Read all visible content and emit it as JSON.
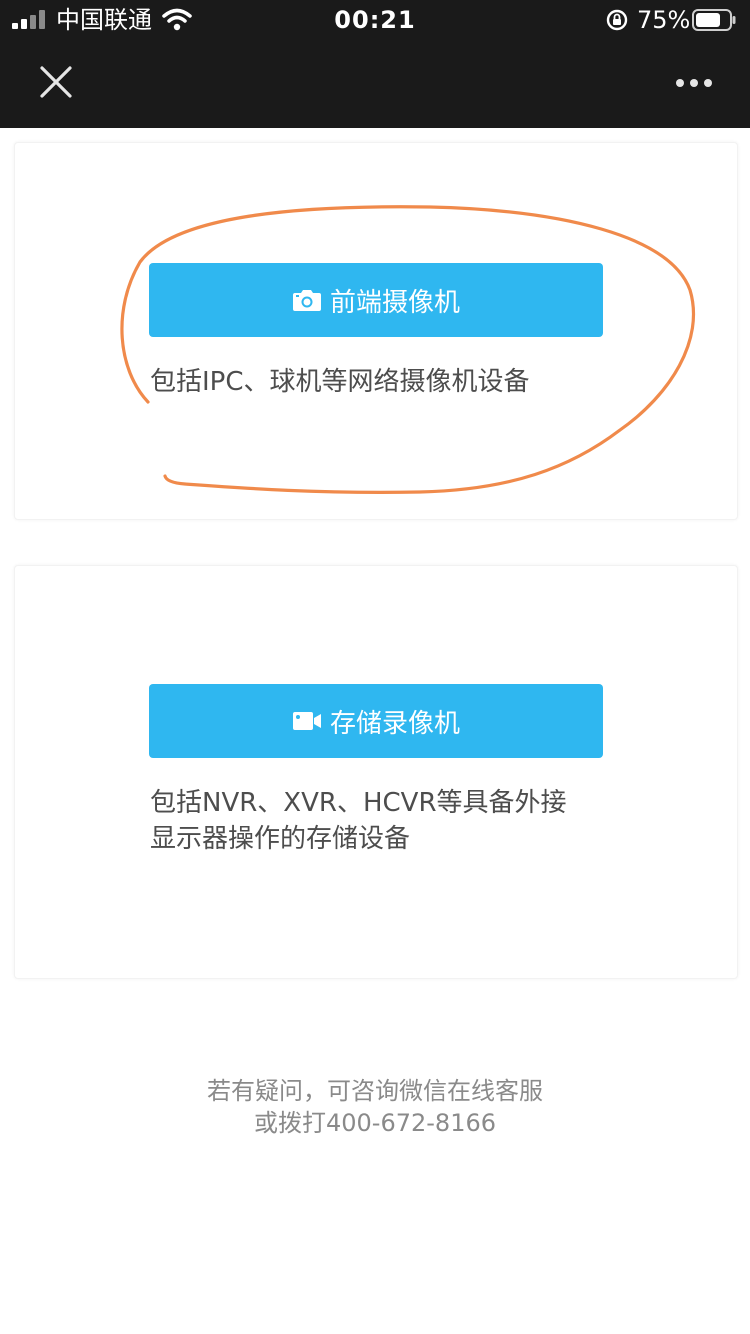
{
  "status_bar": {
    "carrier": "中国联通",
    "time": "00:21",
    "battery_percent": "75%",
    "battery_level": 0.75
  },
  "nav": {
    "close_icon": "close-icon",
    "more_icon": "more-dots-icon"
  },
  "options": [
    {
      "button_label": "前端摄像机",
      "icon": "camera-icon",
      "description_lines": [
        "包括IPC、球机等网络摄像机设备"
      ]
    },
    {
      "button_label": "存储录像机",
      "icon": "video-camera-icon",
      "description_lines": [
        "包括NVR、XVR、HCVR等具备外接",
        "显示器操作的存储设备"
      ]
    }
  ],
  "help": {
    "line1": "若有疑问，可咨询微信在线客服",
    "line2": "或拨打400-672-8166"
  },
  "colors": {
    "topbar": "#1a1a1a",
    "button": "#2fb7f0",
    "annotation": "#f08a4b",
    "description_text": "#4d4d4d",
    "help_text": "#8a8a8a"
  }
}
